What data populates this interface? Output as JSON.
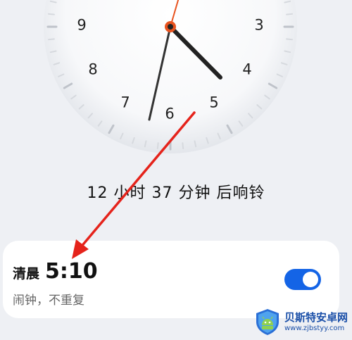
{
  "clock": {
    "numerals": [
      "9",
      "3",
      "8",
      "4",
      "7",
      "6",
      "5"
    ],
    "colors": {
      "face": "#ffffff",
      "hands": "#222222",
      "second_hand": "#e8531f",
      "ticks": "#c9ccd2"
    }
  },
  "countdown": {
    "text": "12 小时 37 分钟 后响铃"
  },
  "alarm": {
    "period": "清晨",
    "time": "5:10",
    "description": "闹钟，不重复",
    "enabled": true,
    "toggle_color": "#1464e6"
  },
  "annotation": {
    "arrow_color": "#e5231b"
  },
  "watermark": {
    "title": "贝斯特安卓网",
    "url": "www.zjbstyy.com",
    "logo_icon": "android-shield-logo-icon"
  }
}
